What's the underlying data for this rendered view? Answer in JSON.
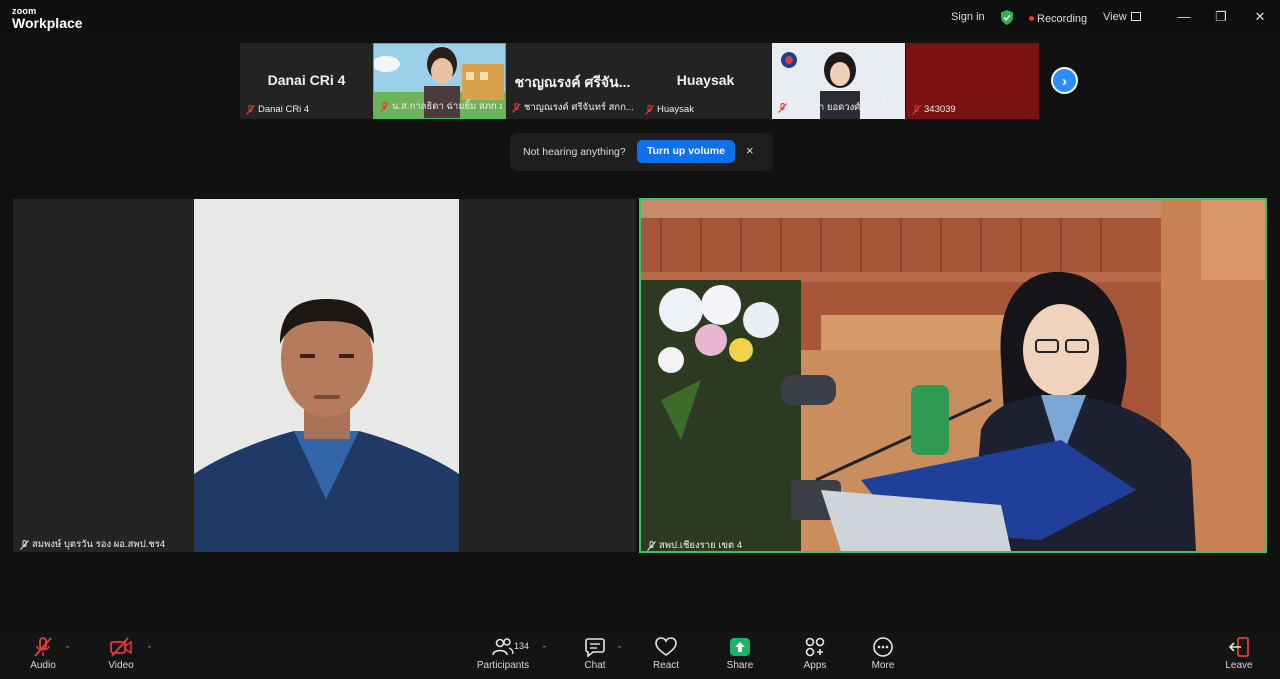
{
  "app": {
    "brand_top": "zoom",
    "brand_main": "Workplace",
    "sign_in": "Sign in",
    "recording": "Recording",
    "view": "View"
  },
  "filmstrip": [
    {
      "name": "Danai CRi 4",
      "label": "Danai CRi 4",
      "video": false
    },
    {
      "name": "",
      "label": "น.ส.กาลธิดา ฉ่ามยิ้ม สภก.ส...",
      "video": true
    },
    {
      "name": "ชาญณรงค์ ศรีจัน...",
      "label": "ชาญณรงค์ ศรีจันทร์ สกก...",
      "video": false
    },
    {
      "name": "Huaysak",
      "label": "Huaysak",
      "video": false
    },
    {
      "name": "",
      "label": "ปณฑิตา ยอดวงศ์ โรงเรียน...",
      "video": true
    },
    {
      "name": "",
      "label": "343039",
      "video": false
    }
  ],
  "toast": {
    "text": "Not hearing anything?",
    "button": "Turn up volume",
    "close": "×"
  },
  "main": {
    "left_name": "สมพงษ์ บุตรวัน รอง ผอ.สพป.ชร4",
    "right_name": "สพป.เชียงราย เขต 4"
  },
  "toolbar": {
    "audio": "Audio",
    "video": "Video",
    "participants": "Participants",
    "participants_count": "134",
    "chat": "Chat",
    "react": "React",
    "share": "Share",
    "apps": "Apps",
    "more": "More",
    "leave": "Leave"
  },
  "colors": {
    "accent": "#0e71eb",
    "active_speaker": "#39c46a",
    "muted": "#e03b3b"
  },
  "icons": [
    "shield-icon",
    "mic-off-icon",
    "video-off-icon",
    "participants-icon",
    "chat-icon",
    "react-icon",
    "share-icon",
    "apps-icon",
    "more-icon",
    "leave-icon",
    "chevron-right-icon",
    "close-icon"
  ]
}
